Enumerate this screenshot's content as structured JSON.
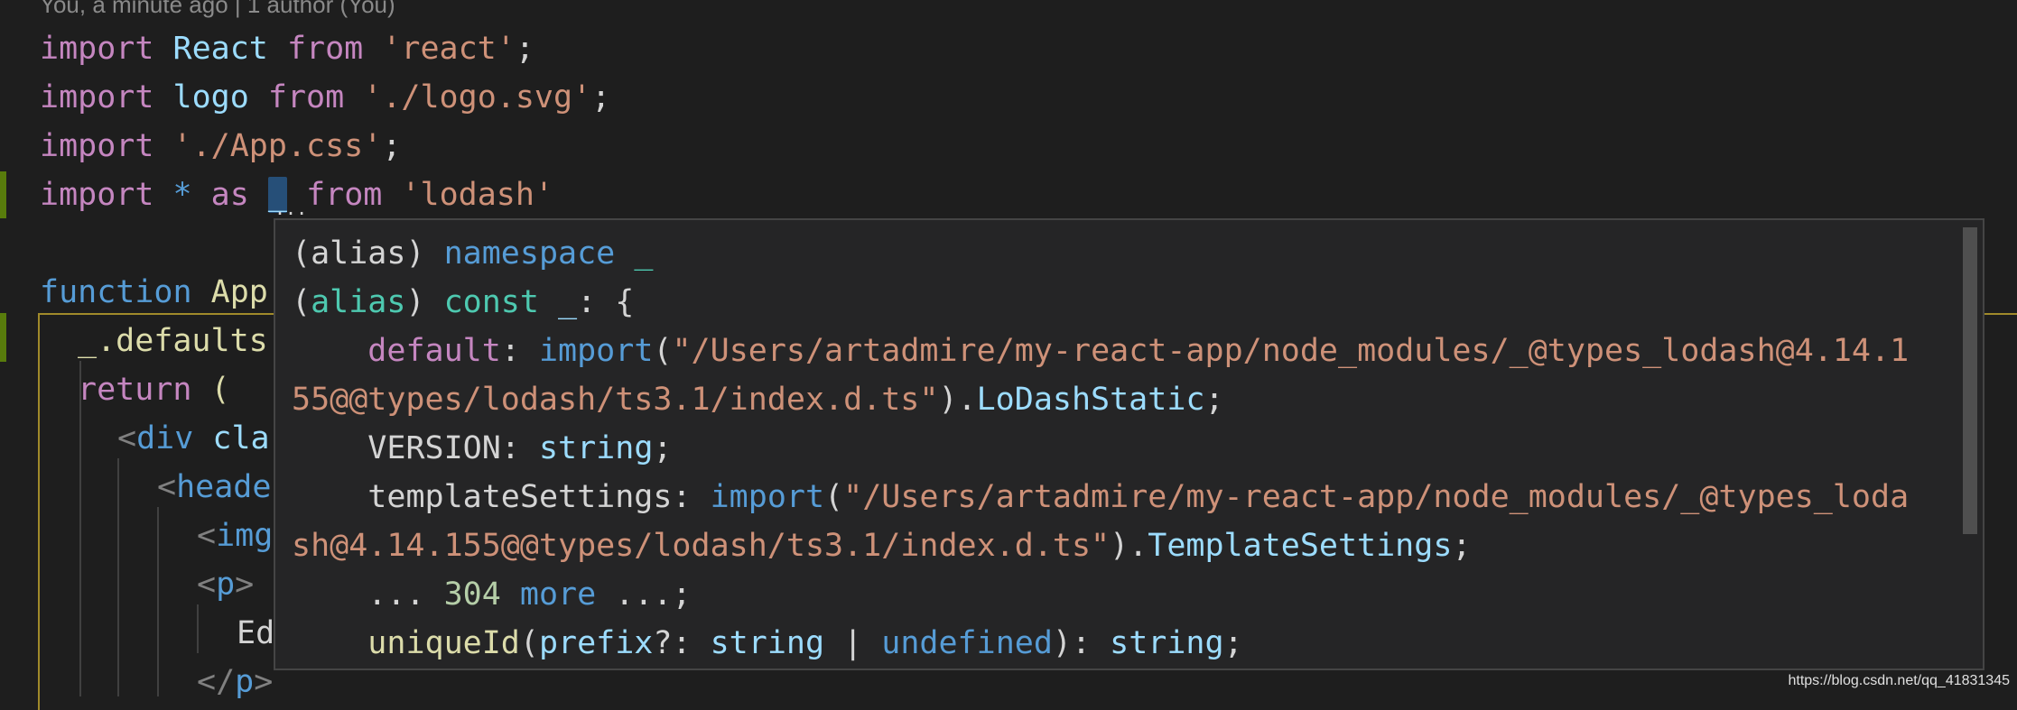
{
  "codelens": "You, a minute ago | 1 author (You)",
  "editor": {
    "line1": {
      "kw": "import",
      "id": "React",
      "from": "from",
      "str": "'react'",
      "end": ";"
    },
    "line2": {
      "kw": "import",
      "id": "logo",
      "from": "from",
      "str": "'./logo.svg'",
      "end": ";"
    },
    "line3": {
      "kw": "import",
      "str": "'./App.css'",
      "end": ";"
    },
    "line4": {
      "kw": "import",
      "star": "*",
      "as": "as",
      "id": "_",
      "from": "from",
      "str": "'lodash'"
    },
    "line6": {
      "kw": "function",
      "name": "App"
    },
    "line7": {
      "text": "_.defaults"
    },
    "line8": {
      "kw": "return",
      "paren": "("
    },
    "line9": {
      "open": "<",
      "tag": "div",
      "attr": "cla"
    },
    "line10": {
      "open": "<",
      "tag": "heade"
    },
    "line11": {
      "open": "<",
      "tag": "img"
    },
    "line12": {
      "open": "<",
      "tag": "p",
      "close": ">"
    },
    "line13": {
      "text": "Ed"
    },
    "line14": {
      "open": "</",
      "tag": "p",
      "close": ">"
    }
  },
  "hover": {
    "l1": {
      "p1": "(",
      "alias": "alias",
      "p2": ")",
      "kw": "namespace",
      "id": "_"
    },
    "l2": {
      "p1": "(",
      "alias": "alias",
      "p2": ")",
      "kw": "const",
      "id": "_",
      "rest": ": {"
    },
    "l3": {
      "indent": "    ",
      "prop": "default",
      "colon": ": ",
      "imp": "import",
      "paren": "(",
      "path": "\"/Users/artadmire/my-react-app/node_modules/_@types_lodash@4.14.1"
    },
    "l4": {
      "path": "55@@types/lodash/ts3.1/index.d.ts\"",
      "paren": ").",
      "type": "LoDashStatic",
      "end": ";"
    },
    "l5": {
      "indent": "    ",
      "prop": "VERSION",
      "colon": ": ",
      "type": "string",
      "end": ";"
    },
    "l6": {
      "indent": "    ",
      "prop": "templateSettings",
      "colon": ": ",
      "imp": "import",
      "paren": "(",
      "path": "\"/Users/artadmire/my-react-app/node_modules/_@types_loda"
    },
    "l7": {
      "path": "sh@4.14.155@@types/lodash/ts3.1/index.d.ts\"",
      "paren": ").",
      "type": "TemplateSettings",
      "end": ";"
    },
    "l8": {
      "indent": "    ",
      "dots1": "...",
      "num": "304",
      "more": "more",
      "dots2": "...",
      "end": ";"
    },
    "l9": {
      "indent": "    ",
      "fn": "uniqueId",
      "p1": "(",
      "param": "prefix",
      "q": "?: ",
      "t1": "string",
      "bar": " | ",
      "t2": "undefined",
      "p2": "): ",
      "t3": "string",
      "end": ";"
    }
  },
  "watermark": "https://blog.csdn.net/qq_41831345",
  "colors": {
    "background": "#1e1e1e",
    "hover_bg": "#252526",
    "keyword": "#c586c0",
    "string": "#ce9178",
    "variable": "#9cdcfe",
    "type": "#4ec9b0",
    "function": "#dcdcaa",
    "git_added": "#587c0c"
  }
}
